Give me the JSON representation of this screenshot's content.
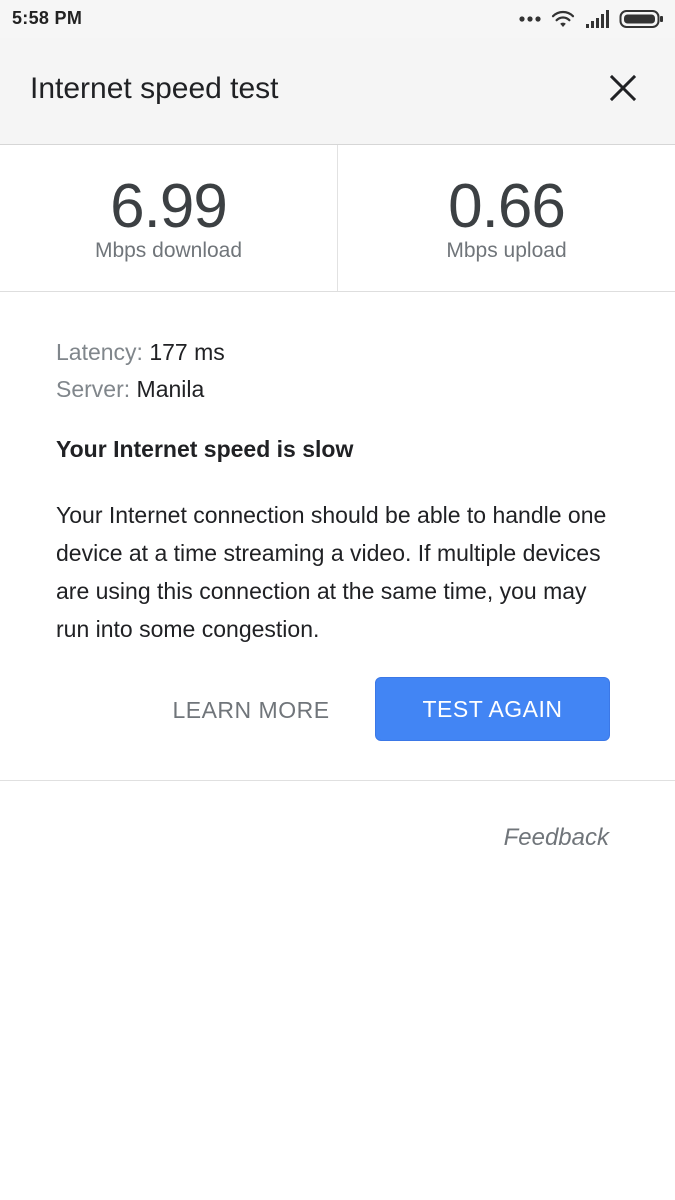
{
  "status_bar": {
    "time": "5:58 PM",
    "icons": [
      "more-dots-icon",
      "wifi-icon",
      "signal-icon",
      "battery-icon"
    ]
  },
  "header": {
    "title": "Internet speed test",
    "close_icon": "close-icon"
  },
  "results": {
    "download": {
      "value": "6.99",
      "unit": "Mbps download"
    },
    "upload": {
      "value": "0.66",
      "unit": "Mbps upload"
    }
  },
  "details": {
    "latency_label": "Latency:",
    "latency_value": "177 ms",
    "server_label": "Server:",
    "server_value": "Manila"
  },
  "assessment": {
    "heading": "Your Internet speed is slow",
    "description": "Your Internet connection should be able to handle one device at a time streaming a video. If multiple devices are using this connection at the same time, you may run into some congestion."
  },
  "actions": {
    "learn_more": "LEARN MORE",
    "test_again": "TEST AGAIN"
  },
  "footer": {
    "feedback": "Feedback"
  },
  "colors": {
    "accent": "#4285f4",
    "header_bg": "#f5f5f5",
    "secondary_text": "#70757a"
  }
}
